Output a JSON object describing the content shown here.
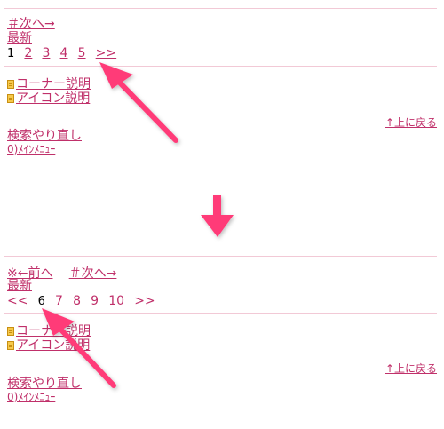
{
  "before": {
    "nav": {
      "next": "＃次へ→"
    },
    "latest": "最新",
    "pages": [
      "1",
      "2",
      "3",
      "4",
      "5",
      ">>"
    ],
    "current_page": "1",
    "links": [
      "コーナー説明",
      "アイコン説明"
    ],
    "back_to_top": "↑上に戻る",
    "search_again": "検索やり直し",
    "main_menu": "0)ﾒｲﾝﾒﾆｭｰ"
  },
  "after": {
    "nav": {
      "prev": "※←前へ",
      "next": "＃次へ→"
    },
    "latest": "最新",
    "pages": [
      "<<",
      "6",
      "7",
      "8",
      "9",
      "10",
      ">>"
    ],
    "current_page": "6",
    "links": [
      "コーナー説明",
      "アイコン説明"
    ],
    "back_to_top": "↑上に戻る",
    "search_again": "検索やり直し",
    "main_menu": "0)ﾒｲﾝﾒﾆｭｰ"
  },
  "colors": {
    "link": "#c0306a",
    "arrow": "#ff3a78",
    "divider": "#f2c9d6",
    "current": "#000000"
  },
  "icons": {
    "doc": "document-icon",
    "arrow": "pointer-arrow-icon",
    "transition": "down-arrow-icon"
  }
}
